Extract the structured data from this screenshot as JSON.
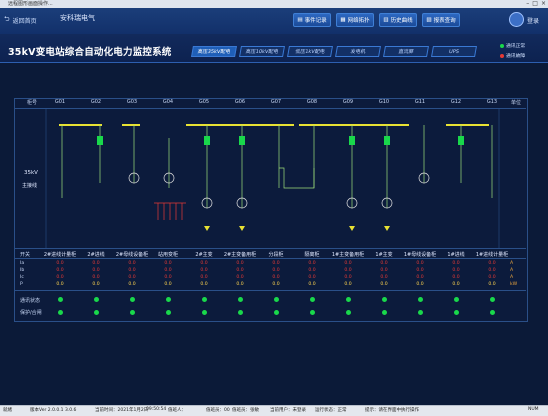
{
  "window": {
    "title": "远程图形画面操作..."
  },
  "topbar": {
    "home_label": "返回首页",
    "brand": "安科瑞电气",
    "nav": [
      "事件记录",
      "网络拓扑",
      "历史曲线",
      "报表查询"
    ],
    "login": "登录"
  },
  "system": {
    "title": "35kV变电站综合自动化电力监控系统",
    "tabs": [
      "高压35kV配电",
      "高压10kV配电",
      "低压1kV配电",
      "发电机",
      "直流屏",
      "UPS"
    ],
    "active_tab": 0,
    "status": [
      {
        "label": "通讯正常",
        "color": "#19d84b"
      },
      {
        "label": "通讯故障",
        "color": "#e53935"
      }
    ]
  },
  "diagram": {
    "header_left": "柜号",
    "header_right": "单位",
    "cabinets": [
      "G01",
      "G02",
      "G03",
      "G04",
      "G05",
      "G06",
      "G07",
      "G08",
      "G09",
      "G10",
      "G11",
      "G12",
      "G13"
    ],
    "bus_label_1": "35kV",
    "bus_label_2": "主接线",
    "row_names": "开关",
    "cabinet_names": [
      "2#进线计量柜",
      "2#进线",
      "2#母线设备柜",
      "站用变柜",
      "2#主变",
      "2#主变备用柜",
      "分段柜",
      "隔离柜",
      "1#主变备用柜",
      "1#主变",
      "1#母线设备柜",
      "1#进线",
      "1#进线计量柜"
    ],
    "phase_labels": [
      "Ia",
      "Ib",
      "Ic",
      "P"
    ],
    "units": [
      "A",
      "A",
      "A",
      "kW"
    ],
    "value": "0.0",
    "comm_status_label": "通讯状态",
    "switch_status_label": "保护/合闸"
  },
  "statusbar": {
    "items": [
      "就绪",
      "版本Ver 2.0.0.1 3.0.6",
      "当前时间：2021年1月2日",
      "09:50:54",
      "值班人：",
      "值班员：00",
      "值班员：张敏",
      "当前用户：未登录",
      "运行状态：正常",
      "提示：请在界面中执行操作",
      "NUM"
    ]
  }
}
